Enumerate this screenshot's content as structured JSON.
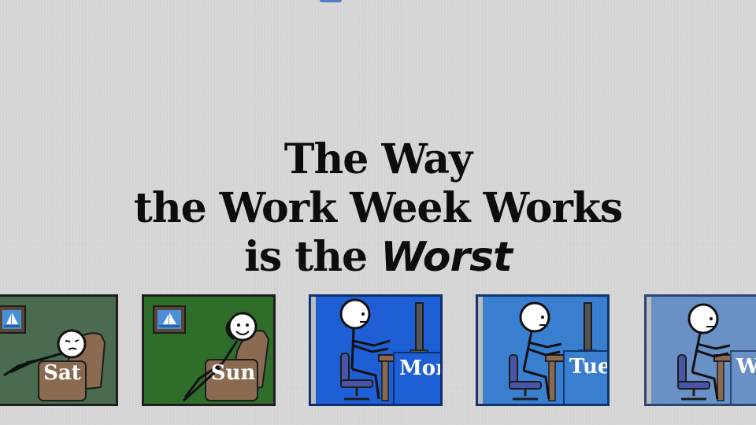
{
  "title": {
    "line1": "The Way",
    "line2": "the Work Week Works",
    "line3_prefix": "is the ",
    "line3_emphasis": "Worst"
  },
  "panels": [
    {
      "day": "Sat",
      "type": "weekend",
      "color": "#4a6b4d"
    },
    {
      "day": "Sun",
      "type": "weekend",
      "color": "#2e6d2a"
    },
    {
      "day": "Mon",
      "type": "work",
      "color": "#1f5fd6"
    },
    {
      "day": "Tue",
      "type": "work",
      "color": "#3a7ed0"
    },
    {
      "day": "W",
      "type": "work",
      "color": "#6a91c6"
    }
  ],
  "colors": {
    "text": "#0d0d0d",
    "background": "#d6d6d6",
    "chair": "#8a6b52",
    "accent_tab": "#4f7fc4"
  }
}
